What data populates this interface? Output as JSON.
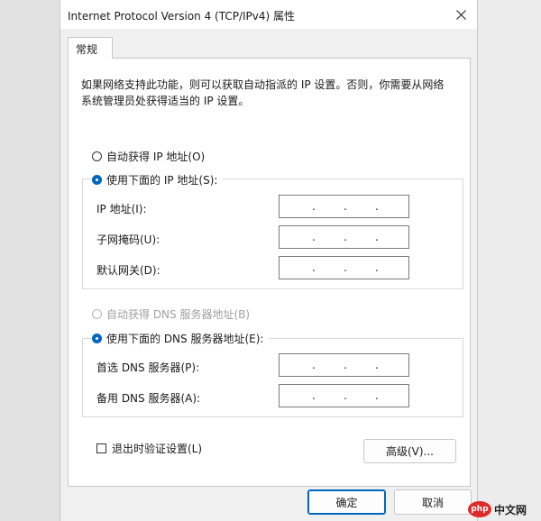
{
  "window": {
    "title": "Internet Protocol Version 4 (TCP/IPv4) 属性",
    "close_icon": "close-icon"
  },
  "tabs": [
    {
      "label": "常规",
      "selected": true
    }
  ],
  "general": {
    "description": "如果网络支持此功能，则可以获取自动指派的 IP 设置。否则，你需要从网络系统管理员处获得适当的 IP 设置。",
    "ip_auto_label": "自动获得 IP 地址(O)",
    "ip_manual_label": "使用下面的 IP 地址(S):",
    "ip_mode": "manual",
    "ip_fields": [
      {
        "label": "IP 地址(I):",
        "value": ". . ."
      },
      {
        "label": "子网掩码(U):",
        "value": ". . ."
      },
      {
        "label": "默认网关(D):",
        "value": ". . ."
      }
    ],
    "dns_auto_label": "自动获得 DNS 服务器地址(B)",
    "dns_manual_label": "使用下面的 DNS 服务器地址(E):",
    "dns_mode": "manual",
    "dns_fields": [
      {
        "label": "首选 DNS 服务器(P):",
        "value": ". . ."
      },
      {
        "label": "备用 DNS 服务器(A):",
        "value": ". . ."
      }
    ],
    "validate_label": "退出时验证设置(L)",
    "validate_checked": false,
    "advanced_label": "高级(V)..."
  },
  "footer": {
    "ok_label": "确定",
    "cancel_label": "取消"
  },
  "watermark": {
    "logo": "php",
    "text": "中文网"
  },
  "colors": {
    "accent": "#0067c0",
    "watermark_red": "#e0292a"
  }
}
